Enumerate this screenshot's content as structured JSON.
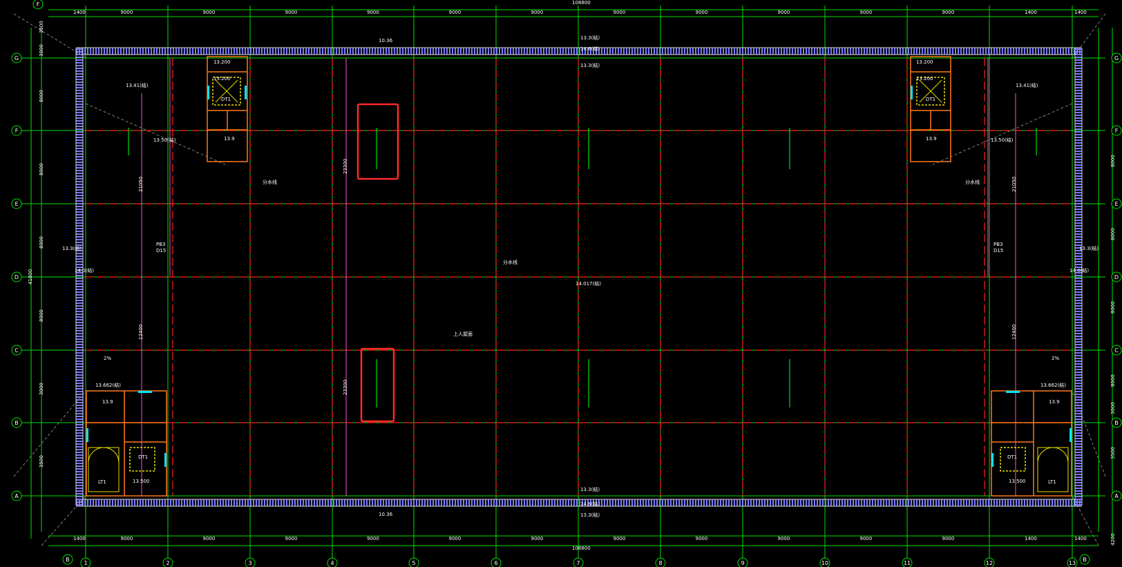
{
  "colors": {
    "background": "#000000",
    "grid": "#00e000",
    "column_grid": "#ff1e1e",
    "wall": "#d8d8d8",
    "wall_hatch": "#7a7aff",
    "text": "#ffffff",
    "pink": "#ff4fd8",
    "cyan": "#00e5ff",
    "yellow": "#e8e000",
    "highlight": "#ff2a2a"
  },
  "grid": {
    "columns": [
      "1",
      "2",
      "3",
      "4",
      "5",
      "6",
      "7",
      "8",
      "9",
      "10",
      "11",
      "12",
      "13"
    ],
    "rows": [
      "A",
      "B",
      "C",
      "D",
      "E",
      "F",
      "G"
    ],
    "extra_row_top": "F",
    "extra_row_bottom": "B",
    "bay_top": [
      "1400",
      "9000",
      "9000",
      "9000",
      "9000",
      "9000",
      "9000",
      "9000",
      "9000",
      "9000",
      "9000",
      "9000",
      "1400"
    ],
    "bay_bottom": [
      "1400",
      "9000",
      "9000",
      "9000",
      "9000",
      "9000",
      "9000",
      "9000",
      "9000",
      "9000",
      "9000",
      "9000",
      "1400"
    ],
    "total_top": "108800",
    "total_bottom": "108800",
    "left_spans": [
      "3500",
      "3000",
      "8000",
      "8000",
      "8000",
      "8000",
      "3000",
      "3500"
    ],
    "left_total": "41800",
    "right_spans": [
      "8000",
      "8000",
      "8000",
      "8000",
      "3000",
      "3500",
      "4200"
    ]
  },
  "elevations": {
    "e1": "13.3(结)",
    "e2": "13.3(结)",
    "e3": "14.6(结)",
    "e4": "13.3(结)",
    "e5": "14.6(结)",
    "e6": "13.3(结)",
    "center": "14.017(结)",
    "left_mid": "13.3(结)",
    "right_mid": "13.3(结)",
    "left_d": "14.0(结)",
    "right_d": "14.0(结)",
    "top_left": "13.41(结)",
    "top_right": "13.41(结)",
    "left_f": "13.50(结)",
    "right_f": "13.50(结)",
    "bl": "13.662(结)",
    "br": "13.662(结)",
    "gutter": "10.36"
  },
  "labels": {
    "up_roof": "上人屋面",
    "dim_vertical": "23300",
    "pb": "PB3",
    "d": "D15",
    "slope": "2%",
    "span_v1": "12400",
    "span_v2": "21050",
    "stair": "LT1",
    "stair_elev": "13.500",
    "core_elev": "13.200",
    "room_elev": "13.9",
    "dt": "DT1",
    "gutter_label": "分水线"
  }
}
